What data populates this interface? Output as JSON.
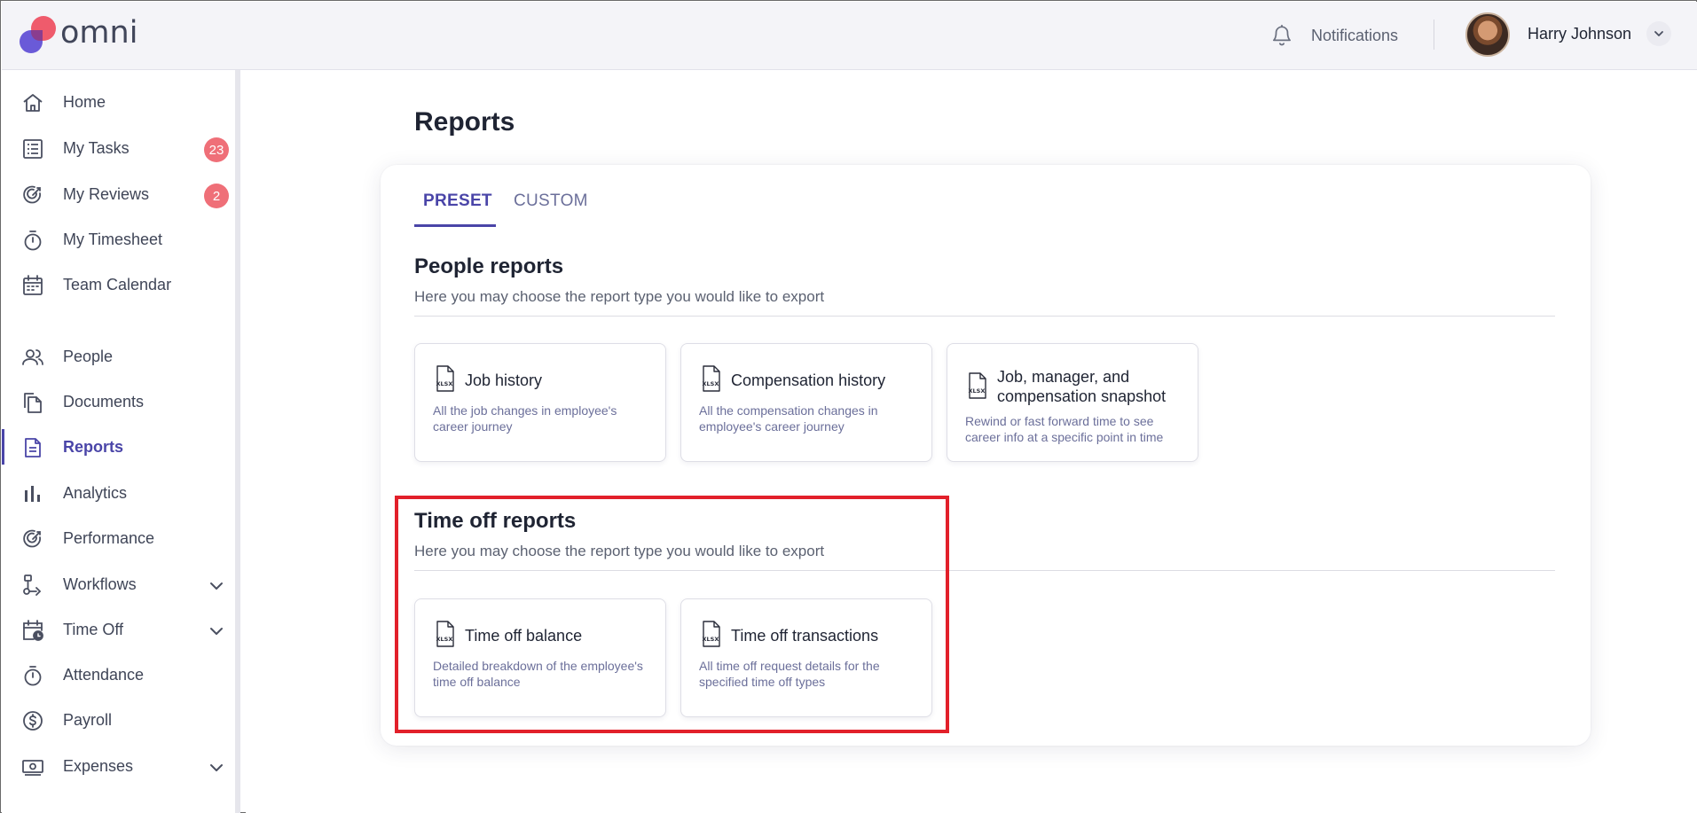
{
  "app": {
    "logo_text": "omni"
  },
  "header": {
    "notifications_label": "Notifications",
    "user_name": "Harry Johnson"
  },
  "sidebar": {
    "items": [
      {
        "label": "Home",
        "icon": "home-icon"
      },
      {
        "label": "My Tasks",
        "icon": "tasks-list-icon",
        "badge": "23"
      },
      {
        "label": "My Reviews",
        "icon": "reviews-icon",
        "badge": "2"
      },
      {
        "label": "My Timesheet",
        "icon": "stopwatch-icon"
      },
      {
        "label": "Team Calendar",
        "icon": "calendar-icon"
      },
      {
        "label": "People",
        "icon": "people-icon"
      },
      {
        "label": "Documents",
        "icon": "documents-icon"
      },
      {
        "label": "Reports",
        "icon": "report-document-icon",
        "active": true
      },
      {
        "label": "Analytics",
        "icon": "bar-chart-icon"
      },
      {
        "label": "Performance",
        "icon": "performance-icon"
      },
      {
        "label": "Workflows",
        "icon": "workflow-icon",
        "expandable": true
      },
      {
        "label": "Time Off",
        "icon": "calendar-clock-icon",
        "expandable": true
      },
      {
        "label": "Attendance",
        "icon": "stopwatch-icon"
      },
      {
        "label": "Payroll",
        "icon": "dollar-circle-icon"
      },
      {
        "label": "Expenses",
        "icon": "cash-icon",
        "expandable": true
      }
    ]
  },
  "main": {
    "title": "Reports",
    "tabs": [
      {
        "label": "PRESET",
        "active": true
      },
      {
        "label": "CUSTOM",
        "active": false
      }
    ],
    "sections": [
      {
        "title": "People reports",
        "subtitle": "Here you may choose the report type you would like to export",
        "reports": [
          {
            "title": "Job history",
            "description": "All the job changes in employee's career journey"
          },
          {
            "title": "Compensation history",
            "description": "All the compensation changes in employee's career journey"
          },
          {
            "title": "Job, manager, and compensation snapshot",
            "description": "Rewind or fast forward time to see career info at a specific point in time"
          }
        ]
      },
      {
        "title": "Time off reports",
        "subtitle": "Here you may choose the report type you would like to export",
        "reports": [
          {
            "title": "Time off balance",
            "description": "Detailed breakdown of the employee's time off balance"
          },
          {
            "title": "Time off transactions",
            "description": "All time off request details for the specified time off types"
          }
        ]
      }
    ]
  },
  "colors": {
    "accent": "#4a45a8",
    "badge": "#ef6f78",
    "highlight": "#e2202a",
    "logo_purple": "#6a5ad8",
    "logo_red": "#ef5b6c"
  }
}
